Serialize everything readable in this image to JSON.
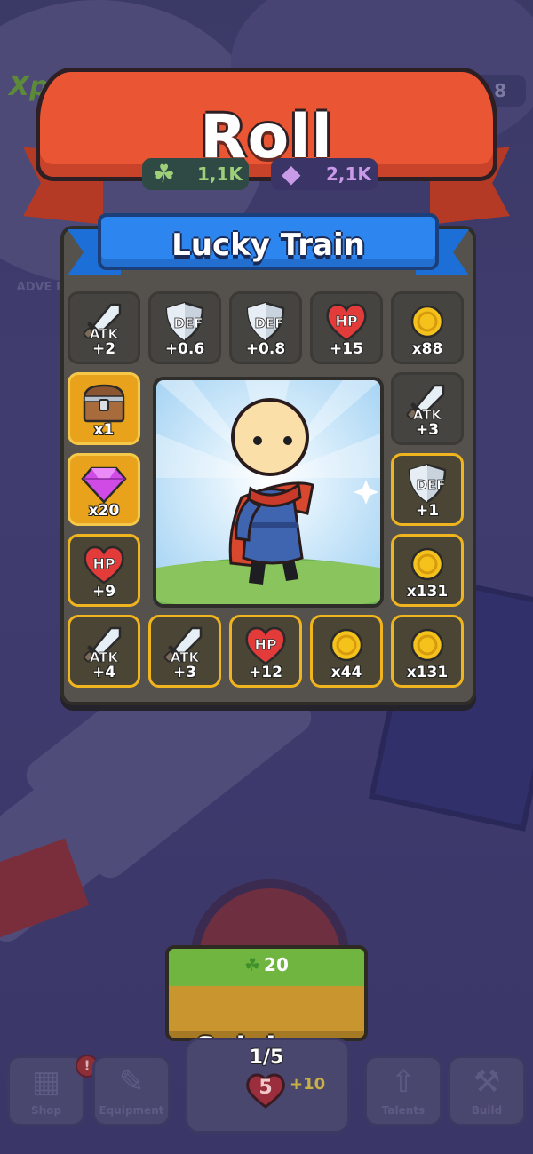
{
  "background": {
    "xp_badge": "Xp",
    "counter_value": "8",
    "adventure_label": "ADVE PA"
  },
  "banner": {
    "title": "Roll"
  },
  "resources": {
    "clover": {
      "icon": "clover-icon",
      "value": "1,1K"
    },
    "gem": {
      "icon": "gem-icon",
      "value": "2,1K"
    }
  },
  "board": {
    "subtitle": "Lucky Train",
    "top_row": [
      {
        "type": "ATK",
        "label": "+2",
        "state": "normal"
      },
      {
        "type": "DEF",
        "label": "+0.6",
        "state": "normal"
      },
      {
        "type": "DEF",
        "label": "+0.8",
        "state": "normal"
      },
      {
        "type": "HP",
        "label": "+15",
        "state": "normal"
      },
      {
        "type": "COIN",
        "label": "x88",
        "state": "normal"
      }
    ],
    "left_col": [
      {
        "type": "CHEST",
        "label": "x1",
        "state": "gold"
      },
      {
        "type": "GEM",
        "label": "x20",
        "state": "gold"
      },
      {
        "type": "HP",
        "label": "+9",
        "state": "lit"
      }
    ],
    "right_col": [
      {
        "type": "ATK",
        "label": "+3",
        "state": "normal"
      },
      {
        "type": "DEF",
        "label": "+1",
        "state": "lit"
      },
      {
        "type": "COIN",
        "label": "x131",
        "state": "lit"
      }
    ],
    "bottom_row": [
      {
        "type": "ATK",
        "label": "+4",
        "state": "lit"
      },
      {
        "type": "ATK",
        "label": "+3",
        "state": "lit"
      },
      {
        "type": "HP",
        "label": "+12",
        "state": "lit"
      },
      {
        "type": "COIN",
        "label": "x44",
        "state": "lit"
      },
      {
        "type": "COIN",
        "label": "x131",
        "state": "lit"
      }
    ]
  },
  "spin": {
    "cost": "20",
    "label": "Spining..",
    "progress": "1/5",
    "dice_value": "5",
    "dice_bonus": "+10"
  },
  "nav": {
    "items": [
      {
        "label": "Shop",
        "icon": "shop-icon",
        "alert": "!"
      },
      {
        "label": "Equipment",
        "icon": "shirt-icon"
      },
      {
        "label": "Talents",
        "icon": "arrow-up-icon"
      },
      {
        "label": "Build",
        "icon": "hammer-icon"
      }
    ]
  },
  "colors": {
    "banner": "#ea5634",
    "ribbon": "#2d86f0",
    "tile_highlight": "#f0b41e",
    "spin_top": "#6fb53f",
    "spin_bottom": "#c8952f"
  }
}
